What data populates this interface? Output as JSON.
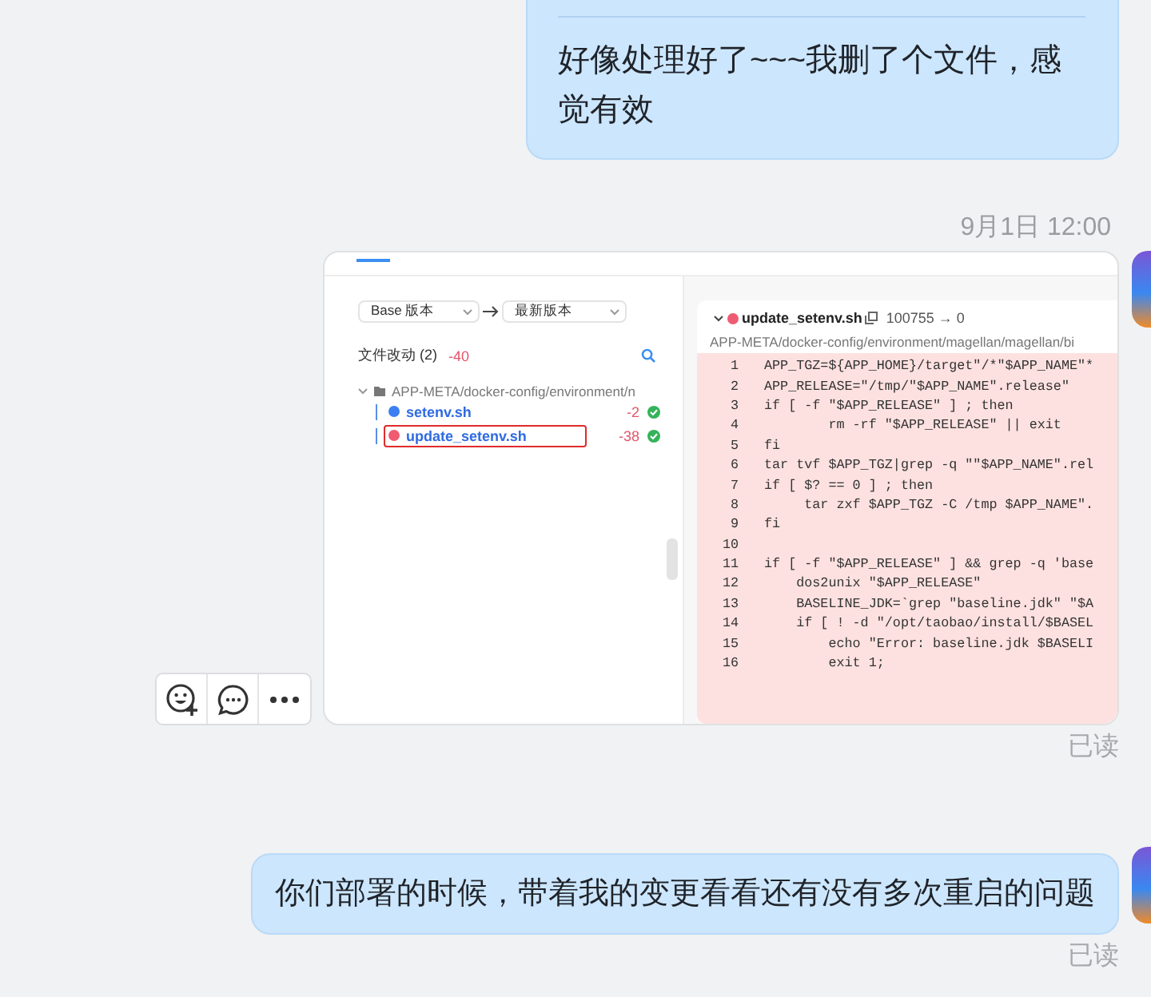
{
  "messages": [
    {
      "kind": "text",
      "text": "好像处理好了~~~我删了个文件，感觉有效"
    },
    {
      "kind": "timestamp",
      "text": "9月1日 12:00"
    },
    {
      "kind": "image",
      "status": "已读",
      "screenshot": {
        "base_select": "Base 版本",
        "target_select": "最新版本",
        "changes_title": "文件改动 (2)",
        "changes_total": "-40",
        "folder": "APP-META/docker-config/environment/n",
        "files": [
          {
            "name": "setenv.sh",
            "kind": "modified",
            "delta": "-2",
            "annotated": false
          },
          {
            "name": "update_setenv.sh",
            "kind": "deleted",
            "delta": "-38",
            "annotated": true
          }
        ],
        "diff": {
          "file": "update_setenv.sh",
          "kind": "deleted",
          "mode": "100755 → 0",
          "path": "APP-META/docker-config/environment/magellan/magellan/bi",
          "lines": [
            {
              "number": "1",
              "code": "APP_TGZ=${APP_HOME}/target\"/*\"$APP_NAME\"*"
            },
            {
              "number": "2",
              "code": "APP_RELEASE=\"/tmp/\"$APP_NAME\".release\""
            },
            {
              "number": "3",
              "code": "if [ -f \"$APP_RELEASE\" ] ; then"
            },
            {
              "number": "4",
              "code": "        rm -rf \"$APP_RELEASE\" || exit"
            },
            {
              "number": "5",
              "code": "fi"
            },
            {
              "number": "6",
              "code": "tar tvf $APP_TGZ|grep -q \"\"$APP_NAME\".rel"
            },
            {
              "number": "7",
              "code": "if [ $? == 0 ] ; then"
            },
            {
              "number": "8",
              "code": "     tar zxf $APP_TGZ -C /tmp $APP_NAME\"."
            },
            {
              "number": "9",
              "code": "fi"
            },
            {
              "number": "10"
            },
            {
              "number": "11",
              "code": "if [ -f \"$APP_RELEASE\" ] && grep -q 'base"
            },
            {
              "number": "12",
              "code": "    dos2unix \"$APP_RELEASE\""
            },
            {
              "number": "13",
              "code": "    BASELINE_JDK=`grep \"baseline.jdk\" \"$A"
            },
            {
              "number": "14",
              "code": "    if [ ! -d \"/opt/taobao/install/$BASEL"
            },
            {
              "number": "15",
              "code": "        echo \"Error: baseline.jdk $BASELI"
            },
            {
              "number": "16",
              "code": "        exit 1;"
            }
          ]
        }
      }
    },
    {
      "kind": "text",
      "text": "你们部署的时候，带着我的变更看看还有没有多次重启的问题",
      "status": "已读"
    }
  ]
}
